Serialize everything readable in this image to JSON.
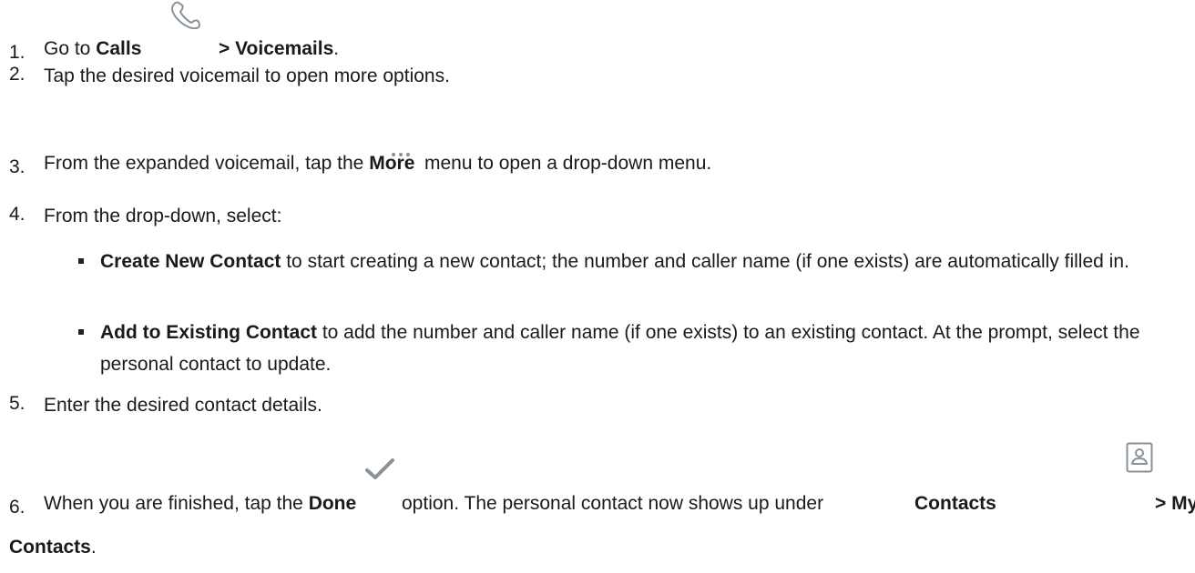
{
  "steps": [
    {
      "number": "1.",
      "pre": "Go to ",
      "bold1": "Calls",
      "icon": "phone-icon",
      "bold2": "> Voicemails",
      "post": "."
    },
    {
      "number": "2.",
      "text": "Tap the desired voicemail to open more options."
    },
    {
      "number": "3.",
      "pre": "From the expanded voicemail, tap the ",
      "bold": "More",
      "icon": "more-dots-icon",
      "post": " menu to open a drop-down menu."
    },
    {
      "number": "4.",
      "text": "From the drop-down, select:",
      "bullets": [
        {
          "bold": "Create New Contact",
          "text": " to start creating a new contact; the number and caller name (if one exists) are automatically filled in."
        },
        {
          "bold": "Add to Existing Contact",
          "text": " to add the number and caller name (if one exists) to an existing contact. At the prompt, select the personal contact to update."
        }
      ]
    },
    {
      "number": "5.",
      "text": "Enter the desired contact details."
    },
    {
      "number": "6.",
      "pre": "When you are finished, tap the ",
      "bold": "Done",
      "icon": "checkmark-icon",
      "mid": " option. The personal contact now shows up under ",
      "bold2": "Contacts",
      "icon2": "contact-card-icon",
      "bold3": "> My",
      "bold4": "Contacts",
      "post": "."
    }
  ],
  "colors": {
    "icon": "#8a9299",
    "checkmark": "#8a9299",
    "text": "#1a1a1a"
  }
}
